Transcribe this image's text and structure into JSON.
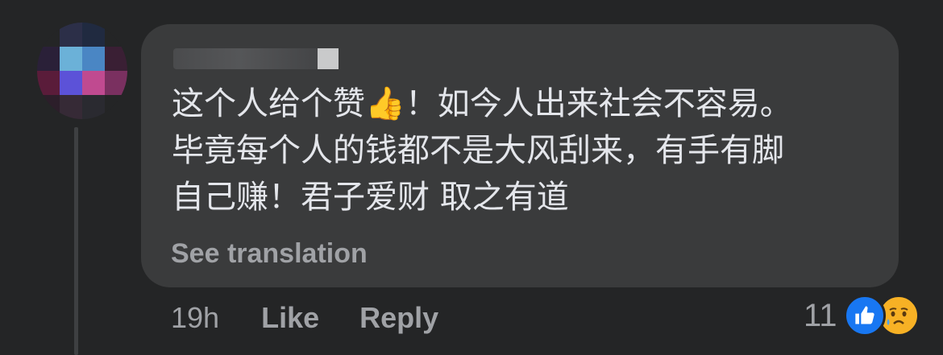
{
  "comment": {
    "text_line1": "这个人给个赞",
    "text_emoji": "👍",
    "text_line1_rest": "！如今人出来社会不容易。",
    "text_line2": "毕竟每个人的钱都不是大风刮来，有手有脚",
    "text_line3": "自己赚！君子爱财 取之有道",
    "see_translation": "See translation"
  },
  "actions": {
    "time": "19h",
    "like": "Like",
    "reply": "Reply"
  },
  "reactions": {
    "count": "11",
    "types": [
      "like-icon",
      "sad-icon"
    ]
  },
  "colors": {
    "background": "#242526",
    "bubble": "#3a3b3c",
    "text": "#e4e6eb",
    "secondary_text": "#a0a2a6",
    "like_blue": "#1877f2",
    "sad_yellow": "#f7b125"
  }
}
